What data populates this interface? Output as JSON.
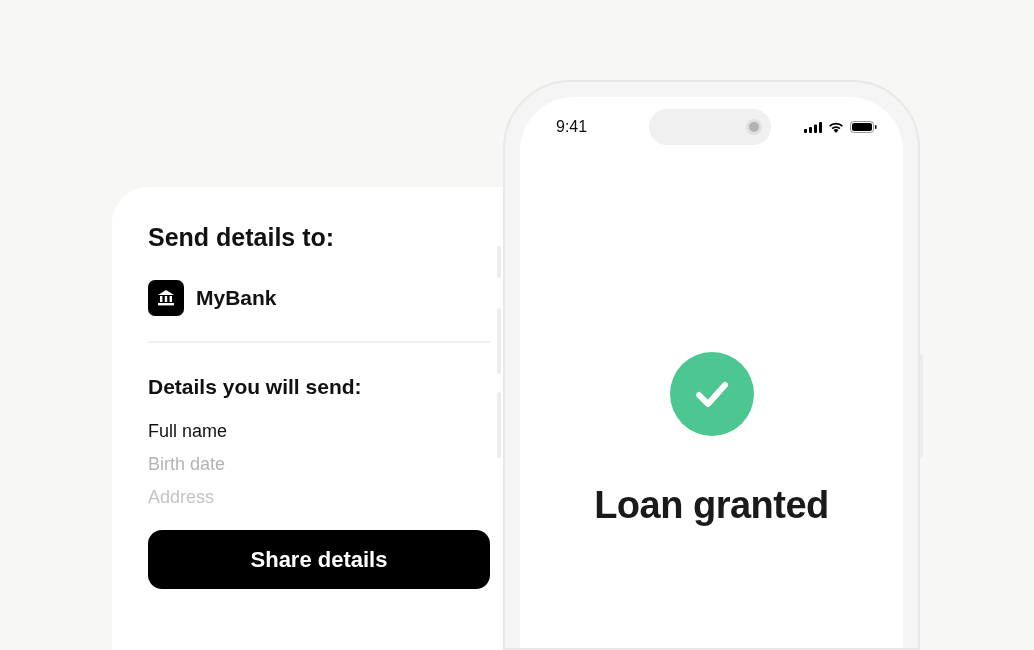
{
  "share_card": {
    "title": "Send details to:",
    "recipient": {
      "name": "MyBank"
    },
    "details_heading": "Details you will send:",
    "details": [
      "Full name",
      "Birth date",
      "Address"
    ],
    "button": "Share details"
  },
  "phone": {
    "status_bar": {
      "time": "9:41"
    },
    "result": {
      "message": "Loan granted"
    }
  }
}
